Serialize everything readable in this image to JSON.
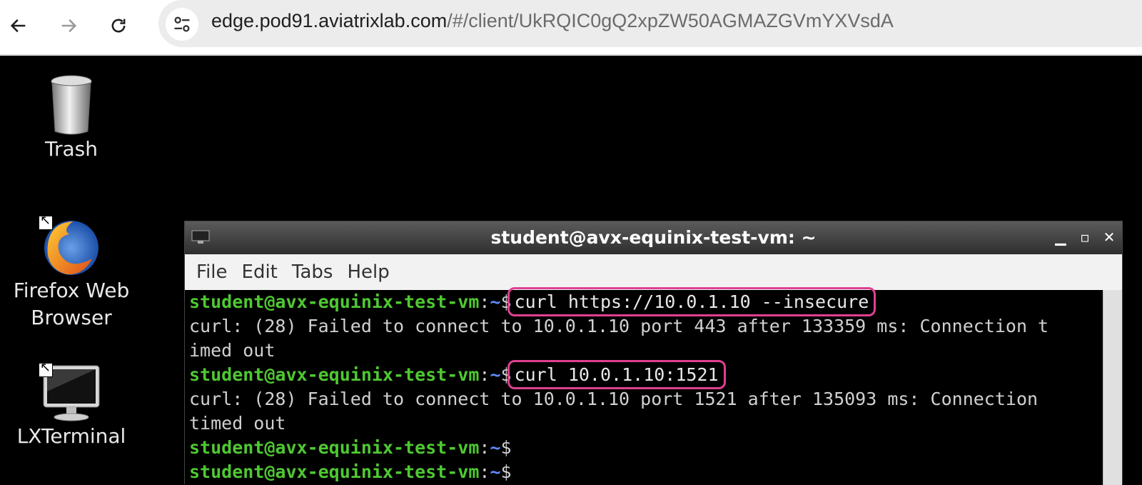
{
  "browser": {
    "url_host": "edge.pod91.aviatrixlab.com",
    "url_path": "/#/client/UkRQIC0gQ2xpZW50AGMAZGVmYXVsdA"
  },
  "desktop": {
    "icons": [
      {
        "label": "Trash",
        "icon": "trash-icon"
      },
      {
        "label": "Firefox Web\nBrowser",
        "icon": "firefox-icon"
      },
      {
        "label": "LXTerminal",
        "icon": "terminal-icon"
      }
    ]
  },
  "terminal": {
    "title": "student@avx-equinix-test-vm: ~",
    "menu": [
      "File",
      "Edit",
      "Tabs",
      "Help"
    ],
    "prompt_user": "student@avx-equinix-test-vm",
    "prompt_path": "~",
    "lines": [
      {
        "type": "prompt",
        "cmd": "curl https://10.0.1.10 --insecure",
        "highlight": true
      },
      {
        "type": "output",
        "text": "curl: (28) Failed to connect to 10.0.1.10 port 443 after 133359 ms: Connection t"
      },
      {
        "type": "output",
        "text": "imed out"
      },
      {
        "type": "prompt",
        "cmd": "curl 10.0.1.10:1521",
        "highlight": true
      },
      {
        "type": "output",
        "text": "curl: (28) Failed to connect to 10.0.1.10 port 1521 after 135093 ms: Connection"
      },
      {
        "type": "output",
        "text": "timed out"
      },
      {
        "type": "prompt",
        "cmd": ""
      },
      {
        "type": "prompt",
        "cmd": ""
      }
    ]
  },
  "colors": {
    "highlight": "#e0408f",
    "prompt_user": "#4fc832",
    "prompt_path": "#5b8cff"
  }
}
